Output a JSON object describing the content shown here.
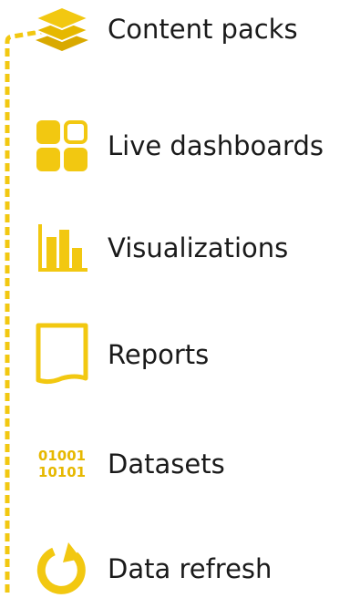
{
  "accent_color": "#F2C811",
  "items": [
    {
      "label": "Content packs",
      "icon": "stacked-layers-icon"
    },
    {
      "label": "Live dashboards",
      "icon": "dashboard-tiles-icon"
    },
    {
      "label": "Visualizations",
      "icon": "bar-chart-icon"
    },
    {
      "label": "Reports",
      "icon": "report-page-icon"
    },
    {
      "label": "Datasets",
      "icon": "binary-data-icon",
      "binary_lines": [
        "01001",
        "10101"
      ]
    },
    {
      "label": "Data refresh",
      "icon": "refresh-icon"
    }
  ]
}
